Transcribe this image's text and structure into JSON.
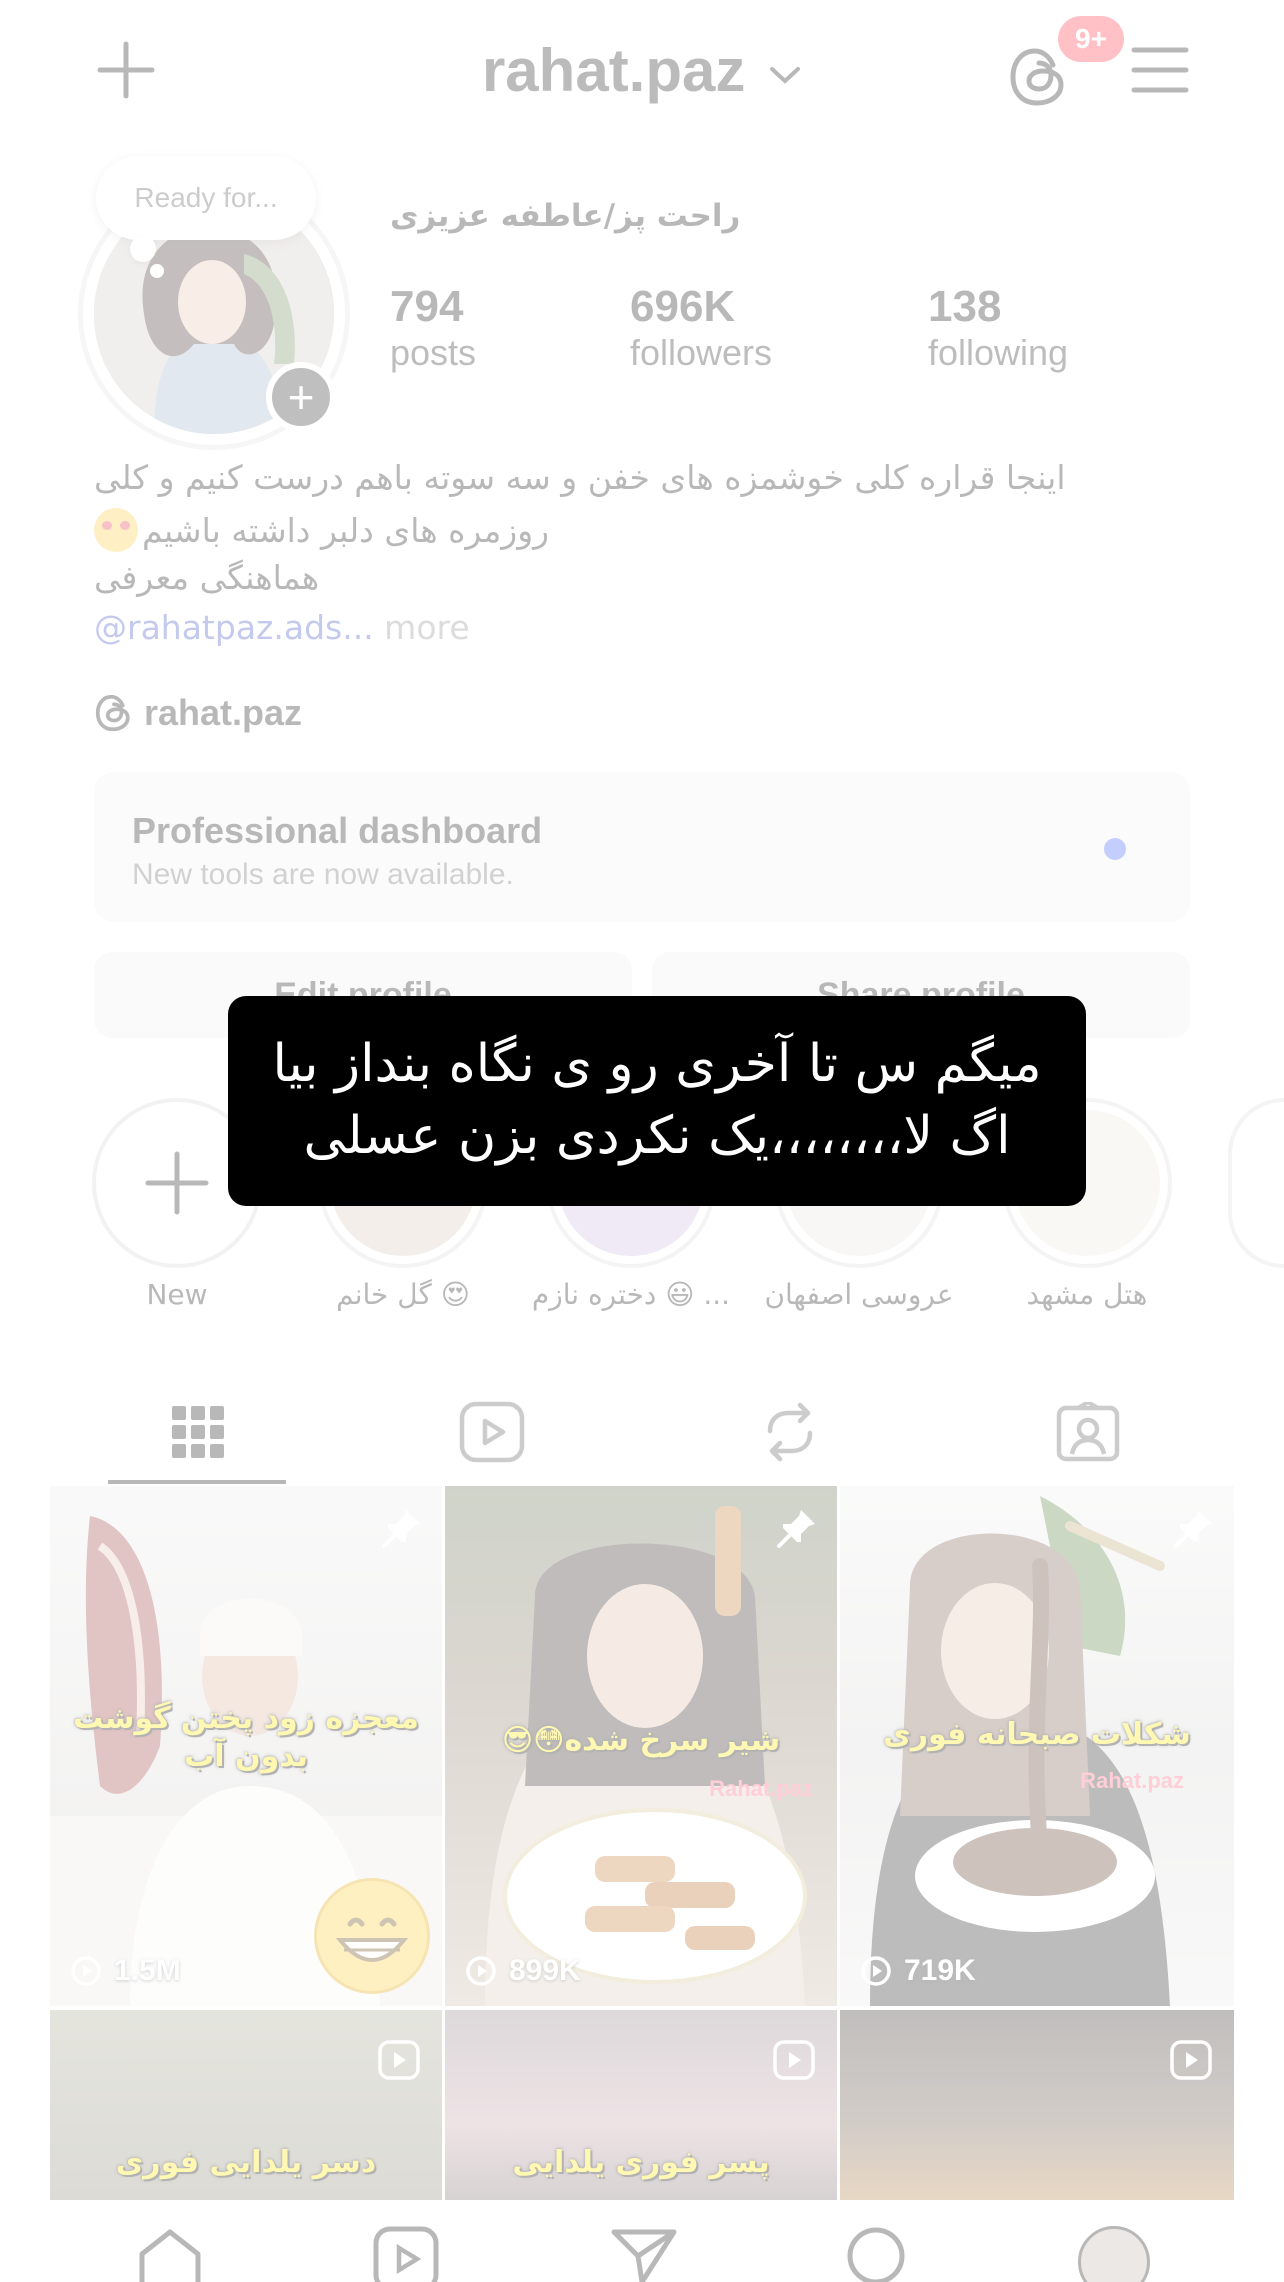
{
  "header": {
    "username": "rahat.paz",
    "notifications_badge": "9+"
  },
  "profile": {
    "note_text": "Ready for...",
    "full_name": "راحت پز/عاطفه عزیزی",
    "stats": [
      {
        "value": "794",
        "label": "posts"
      },
      {
        "value": "696K",
        "label": "followers"
      },
      {
        "value": "138",
        "label": "following"
      }
    ],
    "bio_line1": "اینجا قراره کلی خوشمزه های خفن و سه سوته باهم درست کنیم و کلی",
    "bio_line2": "روزمره های دلبر داشته باشیم",
    "bio_line3": "هماهنگی معرفی",
    "bio_link": "@rahatpaz.ads...",
    "bio_more": " more",
    "threads_handle": "rahat.paz"
  },
  "dashboard": {
    "title": "Professional dashboard",
    "subtitle": "New tools are now available.",
    "accent": "#3b5cf6"
  },
  "buttons": {
    "edit_profile": "Edit profile",
    "share_profile": "Share profile"
  },
  "highlights": [
    {
      "label": "New"
    },
    {
      "label": "گل خانم 😍"
    },
    {
      "label": "دختره نازم 😃 ..."
    },
    {
      "label": "عروسی اصفهان"
    },
    {
      "label": "هتل مشهد"
    }
  ],
  "overlay_caption": {
    "line1": "میگم س تا آخری رو ی نگاه بنداز بیا",
    "line2": "اگ لا،،،،،،،،یک نکردی بزن عسلی"
  },
  "grid": [
    {
      "caption": "معجزه زود پختن گوشت بدون آب",
      "views": "1.5M",
      "pinned": true
    },
    {
      "caption": "شیر سرخ شده😳😎",
      "brand": "Rahat.paz",
      "views": "899K",
      "pinned": true
    },
    {
      "caption": "شکلات صبحانه فوری",
      "brand": "Rahat.paz",
      "views": "719K",
      "pinned": true
    },
    {
      "caption": "دسر یلدایی فوری",
      "reel": true
    },
    {
      "caption": "پسر فوری یلدایی",
      "reel": true
    },
    {
      "caption": "",
      "reel": true
    }
  ],
  "colors": {
    "badge": "#ff3040",
    "caption_text": "#ffe600",
    "link": "#3a4cc7"
  }
}
